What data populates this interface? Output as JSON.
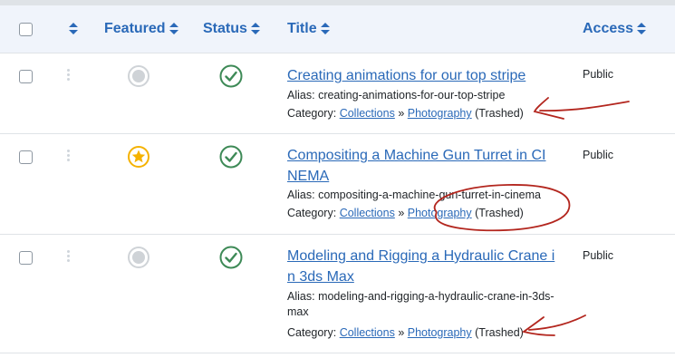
{
  "header": {
    "featured_label": "Featured",
    "status_label": "Status",
    "title_label": "Title",
    "access_label": "Access",
    "sort_icon": "sort-icon",
    "accent_color": "#2a69b8"
  },
  "rows": [
    {
      "title": "Creating animations for our top stripe",
      "alias_label": "Alias:",
      "alias": "creating-animations-for-our-top-stripe",
      "category_label": "Category:",
      "category_parent": "Collections",
      "separator": "»",
      "category_child": "Photography",
      "category_state": "(Trashed)",
      "access": "Public",
      "featured": false,
      "published": true
    },
    {
      "title": "Compositing a Machine Gun Turret in CINEMA",
      "alias_label": "Alias:",
      "alias": "compositing-a-machine-gun-turret-in-cinema",
      "category_label": "Category:",
      "category_parent": "Collections",
      "separator": "»",
      "category_child": "Photography",
      "category_state": "(Trashed)",
      "access": "Public",
      "featured": true,
      "published": true
    },
    {
      "title": "Modeling and Rigging a Hydraulic Crane in 3ds Max",
      "alias_label": "Alias:",
      "alias": "modeling-and-rigging-a-hydraulic-crane-in-3ds-max",
      "category_label": "Category:",
      "category_parent": "Collections",
      "separator": "»",
      "category_child": "Photography",
      "category_state": "(Trashed)",
      "access": "Public",
      "featured": false,
      "published": true
    }
  ],
  "icons": {
    "featured_off": "circle-icon",
    "featured_on": "star-icon",
    "status": "check-circle-icon",
    "drag": "drag-handle-icon"
  },
  "colors": {
    "published_green": "#3e8a57",
    "featured_gold": "#f5b200",
    "unfeatured_grey": "#cfd3d7",
    "annotation_red": "#b3261e"
  }
}
